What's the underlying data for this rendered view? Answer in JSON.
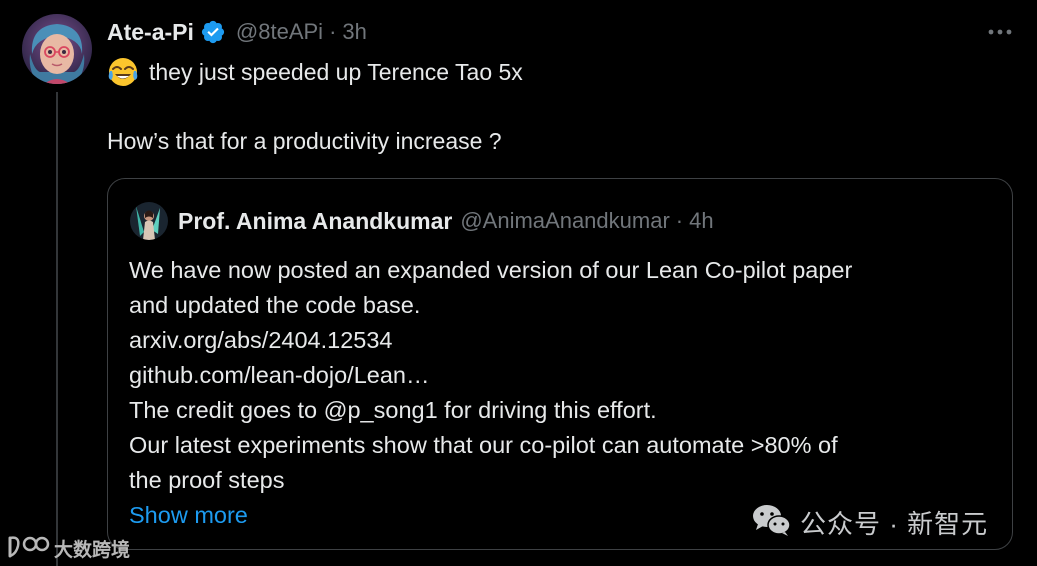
{
  "tweet": {
    "display_name": "Ate-a-Pi",
    "handle": "@8teAPi",
    "separator": "·",
    "time": "3h",
    "text_line1": "they just speeded up Terence Tao 5x",
    "text_line2": "How’s that for a productivity increase ?",
    "emoji": "face-with-tears-of-joy-icon"
  },
  "quote": {
    "display_name": "Prof. Anima Anandkumar",
    "handle": "@AnimaAnandkumar",
    "separator": "·",
    "time": "4h",
    "lines": [
      "We have now posted an expanded version of our Lean Co-pilot paper",
      "and updated the code base.",
      "arxiv.org/abs/2404.12534",
      "github.com/lean-dojo/Lean…",
      "The credit goes to @p_song1 for driving this effort.",
      "Our latest experiments show that our co-pilot can automate >80% of",
      "the proof steps"
    ],
    "show_more": "Show more"
  },
  "watermarks": {
    "wechat": "公众号 · 新智元",
    "bigdata": "大数跨境"
  },
  "colors": {
    "background": "#000000",
    "text": "#e7e9ea",
    "muted": "#71767b",
    "link": "#1d9bf0",
    "verified": "#1d9bf0",
    "border": "#3e4144"
  }
}
